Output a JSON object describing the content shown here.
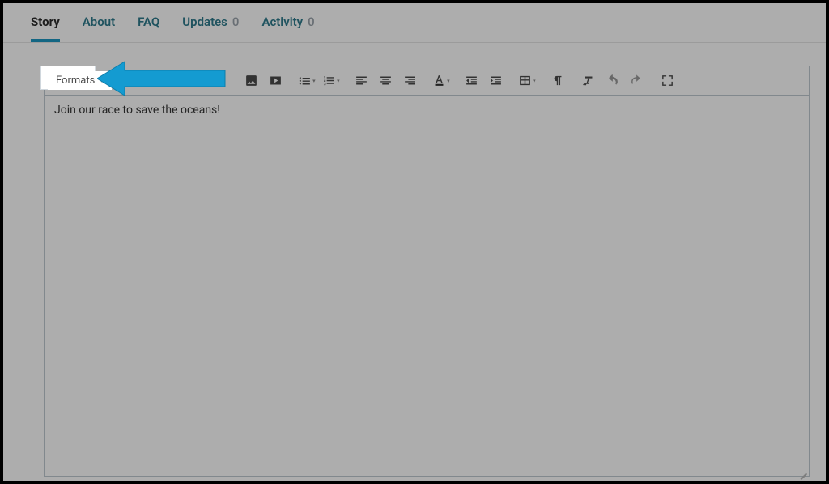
{
  "tabs": [
    {
      "label": "Story",
      "active": true
    },
    {
      "label": "About",
      "active": false
    },
    {
      "label": "FAQ",
      "active": false
    },
    {
      "label": "Updates",
      "count": "0",
      "active": false
    },
    {
      "label": "Activity",
      "count": "0",
      "active": false
    }
  ],
  "toolbar": {
    "formats_label": "Formats"
  },
  "editor": {
    "body": "Join our race to save the oceans!"
  }
}
